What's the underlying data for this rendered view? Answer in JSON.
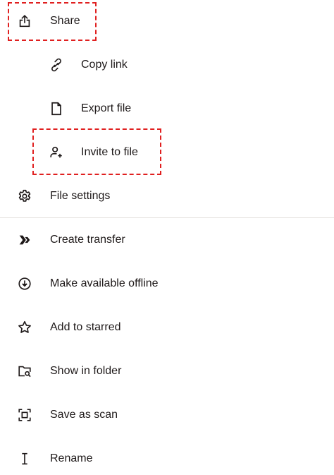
{
  "menu": {
    "items": [
      {
        "key": "share",
        "label": "Share",
        "icon": "share-icon"
      },
      {
        "key": "copy_link",
        "label": "Copy link",
        "icon": "link-icon"
      },
      {
        "key": "export_file",
        "label": "Export file",
        "icon": "file-icon"
      },
      {
        "key": "invite_to_file",
        "label": "Invite to file",
        "icon": "add-person-icon"
      },
      {
        "key": "file_settings",
        "label": "File settings",
        "icon": "gear-icon"
      },
      {
        "key": "create_transfer",
        "label": "Create transfer",
        "icon": "transfer-icon"
      },
      {
        "key": "make_available_offline",
        "label": "Make available offline",
        "icon": "download-circle-icon"
      },
      {
        "key": "add_to_starred",
        "label": "Add to starred",
        "icon": "star-icon"
      },
      {
        "key": "show_in_folder",
        "label": "Show in folder",
        "icon": "folder-search-icon"
      },
      {
        "key": "save_as_scan",
        "label": "Save as scan",
        "icon": "scan-icon"
      },
      {
        "key": "rename",
        "label": "Rename",
        "icon": "text-cursor-icon"
      }
    ]
  },
  "highlight_color": "#e02020",
  "icon_color": "#1e1919"
}
